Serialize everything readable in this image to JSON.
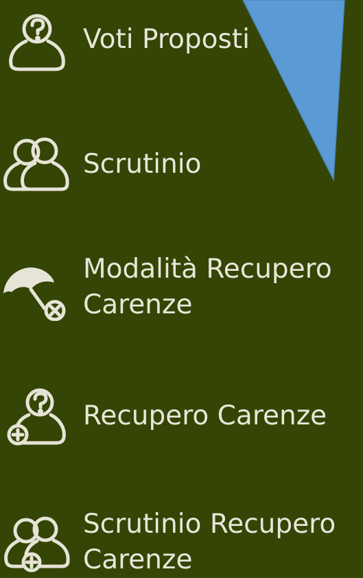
{
  "menu": {
    "items": [
      {
        "icon": "person-question-icon",
        "lines": [
          "Voti Proposti"
        ]
      },
      {
        "icon": "group-users-icon",
        "lines": [
          "Scrutinio"
        ]
      },
      {
        "icon": "umbrella-cancel-icon",
        "lines": [
          "Modalità Recupero",
          "Carenze"
        ]
      },
      {
        "icon": "person-question-add-icon",
        "lines": [
          "Recupero Carenze"
        ]
      },
      {
        "icon": "group-users-add-icon",
        "lines": [
          "Scrutinio Recupero",
          "Carenze"
        ]
      }
    ]
  },
  "colors": {
    "background": "#344505",
    "text": "#e8e6d8",
    "overlay_arrow": "#5b9bd5"
  }
}
